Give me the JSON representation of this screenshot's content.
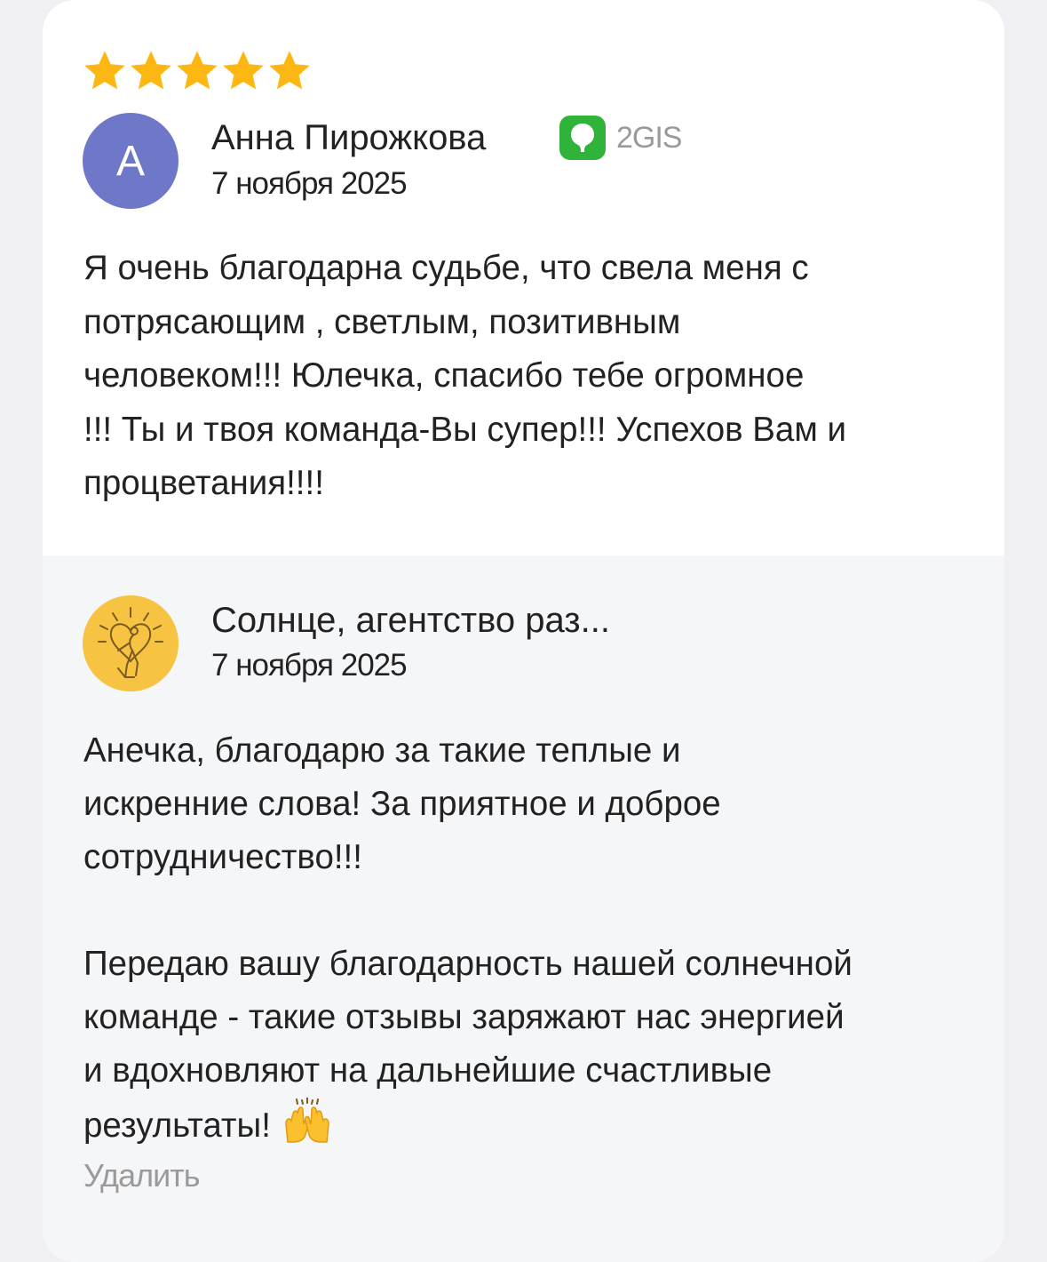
{
  "review": {
    "rating": 5,
    "rating_max": 5,
    "star_color": "#fcb712",
    "author": {
      "initial": "А",
      "name": "Анна Пирожкова",
      "avatar_color": "#6f77c9"
    },
    "date": "7 ноября 2025",
    "source": {
      "name": "2GIS",
      "icon": "2gis-logo-icon",
      "color": "#2fb33b"
    },
    "text": "Я очень благодарна судьбе, что свела меня с\nпотрясающим , светлым, позитивным\nчеловеком!!! Юлечка, спасибо тебе огромное\n!!! Ты и твоя команда-Вы супер!!! Успехов Вам и\nпроцветания!!!!"
  },
  "reply": {
    "organization": {
      "name": "Солнце, агентство раз...",
      "avatar_icon": "sun-heart-logo-icon",
      "avatar_color": "#f6c342"
    },
    "date": "7 ноября 2025",
    "text_part1": "Анечка, благодарю за такие теплые и\nискренние слова! За приятное и доброе\nсотрудничество!!!\n\nПередаю вашу благодарность нашей солнечной\nкоманде - такие отзывы заряжают нас энергией\nи вдохновляют на дальнейшие счастливые\nрезультаты! ",
    "emoji": "raising-hands-emoji",
    "delete_label": "Удалить"
  }
}
